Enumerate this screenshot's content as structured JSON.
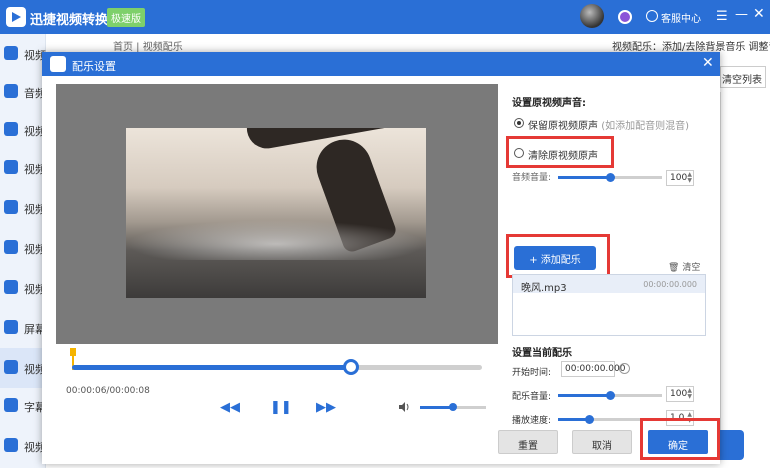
{
  "app": {
    "title": "迅捷视频转换器",
    "badge": "极速版",
    "service_label": "客服中心",
    "menu_icon": "menu-icon",
    "min_icon": "minimize-icon",
    "close_icon": "close-icon"
  },
  "sidebar": {
    "items": [
      {
        "label": "视频转换",
        "icon": "video-convert-icon"
      },
      {
        "label": "音频转换",
        "icon": "audio-icon"
      },
      {
        "label": "视频压缩",
        "icon": "compress-icon"
      },
      {
        "label": "视频分割",
        "icon": "split-icon"
      },
      {
        "label": "视频合并",
        "icon": "merge-icon"
      },
      {
        "label": "视频水印",
        "icon": "watermark-icon"
      },
      {
        "label": "视频转GIF",
        "icon": "gif-icon"
      },
      {
        "label": "屏幕录像",
        "icon": "record-icon"
      },
      {
        "label": "视频配乐",
        "icon": "music-icon"
      },
      {
        "label": "字幕贴图",
        "icon": "subtitle-icon"
      },
      {
        "label": "视频",
        "icon": "video-icon"
      }
    ]
  },
  "main": {
    "breadcrumb": "首页 | 视频配乐",
    "subtitle": "视频配乐：添加/去除背景音乐 调整音量",
    "clear_list": "清空列表"
  },
  "dialog": {
    "title": "配乐设置",
    "close_icon": "close-icon",
    "player": {
      "timecode": "00:00:06/00:00:08",
      "progress": 0.68,
      "volume": 0.5,
      "rewind_icon": "rewind-icon",
      "pause_icon": "pause-icon",
      "forward_icon": "fast-forward-icon",
      "volume_icon": "volume-icon"
    },
    "panel": {
      "original_title": "设置原视频声音:",
      "keep_original": "保留原视频原声",
      "keep_hint": "(如添加配音则混音)",
      "clear_original": "清除原视频原声",
      "original_volume_label": "音频音量:",
      "original_volume": "100",
      "original_volume_level": 0.5,
      "add_music": "+ 添加配乐",
      "clear": "清空",
      "music_items": [
        {
          "name": "晚风.mp3",
          "duration": "00:00:00.000"
        }
      ],
      "current_title": "设置当前配乐",
      "start_time_label": "开始时间:",
      "start_time": "00:00:00.000",
      "music_volume_label": "配乐音量:",
      "music_volume": "100",
      "music_volume_level": 0.5,
      "speed_label": "播放速度:",
      "speed": "1.0",
      "speed_level": 0.3
    },
    "buttons": {
      "reset": "重置",
      "cancel": "取消",
      "confirm": "确定"
    }
  }
}
